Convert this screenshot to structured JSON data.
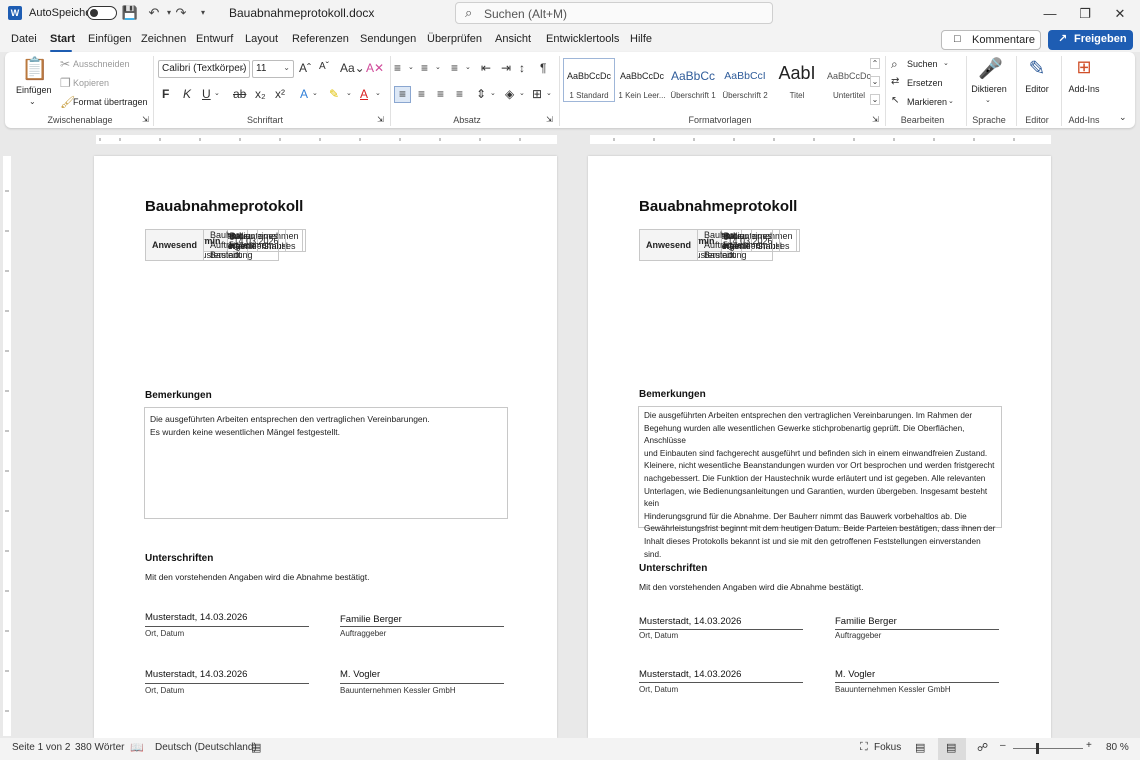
{
  "titlebar": {
    "app_icon": "word-icon",
    "autosave_label": "AutoSpeichern",
    "document_title": "Bauabnahmeprotokoll.docx",
    "search_placeholder": "Suchen (Alt+M)"
  },
  "tabs": [
    "Datei",
    "Start",
    "Einfügen",
    "Zeichnen",
    "Entwurf",
    "Layout",
    "Referenzen",
    "Sendungen",
    "Überprüfen",
    "Ansicht",
    "Entwicklertools",
    "Hilfe"
  ],
  "active_tab": "Start",
  "actions": {
    "comments": "Kommentare",
    "share": "Freigeben"
  },
  "ribbon": {
    "clipboard": {
      "paste": "Einfügen",
      "cut": "Ausschneiden",
      "copy": "Kopieren",
      "format_painter": "Format übertragen",
      "label": "Zwischenablage"
    },
    "font": {
      "family": "Calibri (Textkörper)",
      "size": "11",
      "label": "Schriftart"
    },
    "paragraph": {
      "label": "Absatz"
    },
    "styles": {
      "items": [
        {
          "sample": "AaBbCcDc",
          "name": "1 Standard"
        },
        {
          "sample": "AaBbCcDc",
          "name": "1 Kein Leer..."
        },
        {
          "sample": "AaBbCc",
          "name": "Überschrift 1"
        },
        {
          "sample": "AaBbCcI",
          "name": "Überschrift 2"
        },
        {
          "sample": "AabI",
          "name": "Titel"
        },
        {
          "sample": "AaBbCcDc",
          "name": "Untertitel"
        }
      ],
      "label": "Formatvorlagen"
    },
    "editing": {
      "find": "Suchen",
      "replace": "Ersetzen",
      "select": "Markieren",
      "label": "Bearbeiten"
    },
    "voice": {
      "dictate": "Diktieren",
      "label": "Sprache"
    },
    "editor": {
      "button": "Editor",
      "label": "Editor"
    },
    "addins": {
      "button": "Add-Ins",
      "label": "Add-Ins"
    }
  },
  "document": {
    "title": "Bauabnahmeprotokoll",
    "info_rows": [
      {
        "key": "Bauvorhaben",
        "value": "Neubau eines Einfamilienhauses"
      },
      {
        "key": "Bauort",
        "value": "Ahornweg 12, 12345 Musterstadt"
      },
      {
        "key": "Auftragnehmer",
        "value": "Bauunternehmen Kessler GmbH"
      },
      {
        "key": "Auftraggeber",
        "value": "Familie Berger"
      },
      {
        "key": "Abnahmetermin",
        "value": "14.03.2026"
      },
      {
        "key": "Anwesend",
        "value": "Bauherr, Auftragnehmer, Bauleitung"
      }
    ],
    "remarks_heading": "Bemerkungen",
    "remarks_page1": [
      "Die ausgeführten Arbeiten entsprechen den vertraglichen Vereinbarungen.",
      "Es wurden keine wesentlichen Mängel festgestellt."
    ],
    "remarks_page2": [
      "Die ausgeführten Arbeiten entsprechen den vertraglichen Vereinbarungen. Im Rahmen der",
      "Begehung wurden alle wesentlichen Gewerke stichprobenartig geprüft. Die Oberflächen, Anschlüsse",
      "und Einbauten sind fachgerecht ausgeführt und befinden sich in einem einwandfreien Zustand.",
      "Kleinere, nicht wesentliche Beanstandungen wurden vor Ort besprochen und werden fristgerecht",
      "nachgebessert. Die Funktion der Haustechnik wurde erläutert und ist gegeben. Alle relevanten",
      "Unterlagen, wie Bedienungsanleitungen und Garantien, wurden übergeben. Insgesamt besteht kein",
      "Hinderungsgrund für die Abnahme. Der Bauherr nimmt das Bauwerk vorbehaltlos ab. Die",
      "Gewährleistungsfrist beginnt mit dem heutigen Datum. Beide Parteien bestätigen, dass ihnen der",
      "Inhalt dieses Protokolls bekannt ist und sie mit den getroffenen Feststellungen einverstanden sind."
    ],
    "signatures_heading": "Unterschriften",
    "confirm_text": "Mit den vorstehenden Angaben wird die Abnahme bestätigt.",
    "signatures": [
      {
        "place_date": "Musterstadt, 14.03.2026",
        "place_caption": "Ort, Datum",
        "name": "Familie Berger",
        "role": "Auftraggeber"
      },
      {
        "place_date": "Musterstadt, 14.03.2026",
        "place_caption": "Ort, Datum",
        "name": "M. Vogler",
        "role": "Bauunternehmen Kessler GmbH"
      }
    ]
  },
  "statusbar": {
    "page": "Seite 1 von 2",
    "words": "380 Wörter",
    "language": "Deutsch (Deutschland)",
    "focus": "Fokus",
    "zoom": "80 %"
  },
  "colors": {
    "accent": "#1e5db3",
    "page_bg": "#ffffff",
    "canvas_bg": "#e9e9e9"
  }
}
